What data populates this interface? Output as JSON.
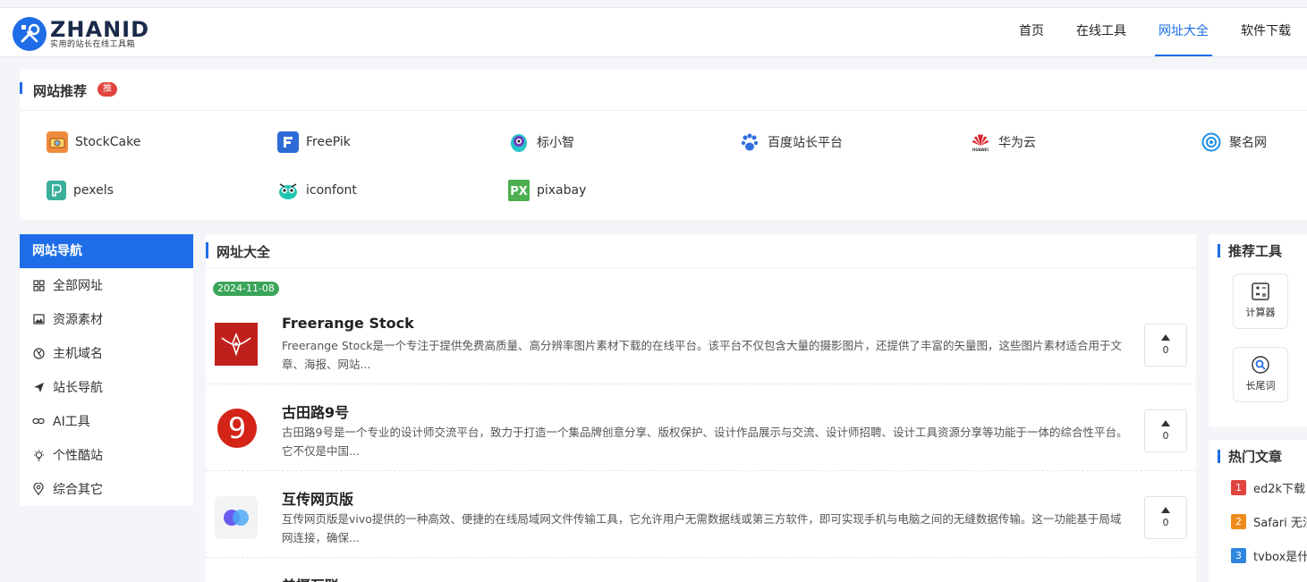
{
  "header": {
    "logo_word": "ZHANID",
    "logo_sub": "实用的站长在线工具箱",
    "nav": [
      {
        "label": "首页",
        "active": false
      },
      {
        "label": "在线工具",
        "active": false
      },
      {
        "label": "网址大全",
        "active": true
      },
      {
        "label": "软件下载",
        "active": false
      }
    ]
  },
  "recommend": {
    "title": "网站推荐",
    "badge": "推",
    "items": [
      {
        "label": "StockCake",
        "icon": "camera-icon",
        "color": "#f08a3c"
      },
      {
        "label": "FreePik",
        "icon": "freepik-icon",
        "color": "#2e6bd6"
      },
      {
        "label": "标小智",
        "icon": "bird-icon",
        "color": "#27c4c9"
      },
      {
        "label": "百度站长平台",
        "icon": "baidu-paw-icon",
        "color": "#3070e0"
      },
      {
        "label": "华为云",
        "icon": "huawei-icon",
        "color": "#d9262c"
      },
      {
        "label": "聚名网",
        "icon": "juming-icon",
        "color": "#1e8fe6"
      },
      {
        "label": "pexels",
        "icon": "pexels-icon",
        "color": "#3aaf9a"
      },
      {
        "label": "iconfont",
        "icon": "iconfont-icon",
        "color": "#1ec6b0"
      },
      {
        "label": "pixabay",
        "icon": "pixabay-icon",
        "color": "#4caf50"
      }
    ]
  },
  "sidebar": {
    "title": "网站导航",
    "items": [
      {
        "label": "全部网址",
        "icon": "grid-icon"
      },
      {
        "label": "资源素材",
        "icon": "image-icon"
      },
      {
        "label": "主机域名",
        "icon": "globe-icon"
      },
      {
        "label": "站长导航",
        "icon": "send-icon"
      },
      {
        "label": "AI工具",
        "icon": "link-icon"
      },
      {
        "label": "个性酷站",
        "icon": "bulb-icon"
      },
      {
        "label": "综合其它",
        "icon": "location-icon"
      }
    ]
  },
  "main": {
    "title": "网址大全",
    "date": "2024-11-08",
    "entries": [
      {
        "title": "Freerange Stock",
        "desc": "Freerange Stock是一个专注于提供免费高质量、高分辨率图片素材下载的在线平台。该平台不仅包含大量的摄影图片，还提供了丰富的矢量图，这些图片素材适合用于文章、海报、网站...",
        "votes": "0"
      },
      {
        "title": "古田路9号",
        "desc": "古田路9号是一个专业的设计师交流平台，致力于打造一个集品牌创意分享、版权保护、设计作品展示与交流、设计师招聘、设计工具资源分享等功能于一体的综合性平台。它不仅是中国...",
        "votes": "0"
      },
      {
        "title": "互传网页版",
        "desc": "互传网页版是vivo提供的一种高效、便捷的在线局域网文件传输工具，它允许用户无需数据线或第三方软件，即可实现手机与电脑之间的无缝数据传输。这一功能基于局域网连接，确保...",
        "votes": "0"
      },
      {
        "title": "美摄互联",
        "desc": "",
        "votes": ""
      }
    ]
  },
  "tools": {
    "title": "推荐工具",
    "items": [
      {
        "label": "计算器",
        "icon": "calculator-icon"
      },
      {
        "label": "长尾词",
        "icon": "search-icon"
      }
    ]
  },
  "hot": {
    "title": "热门文章",
    "items": [
      {
        "num": "1",
        "text": "ed2k下载",
        "color": "#e0443e"
      },
      {
        "num": "2",
        "text": "Safari 无法",
        "color": "#f08a1c"
      },
      {
        "num": "3",
        "text": "tvbox是什",
        "color": "#2e86de"
      }
    ]
  }
}
